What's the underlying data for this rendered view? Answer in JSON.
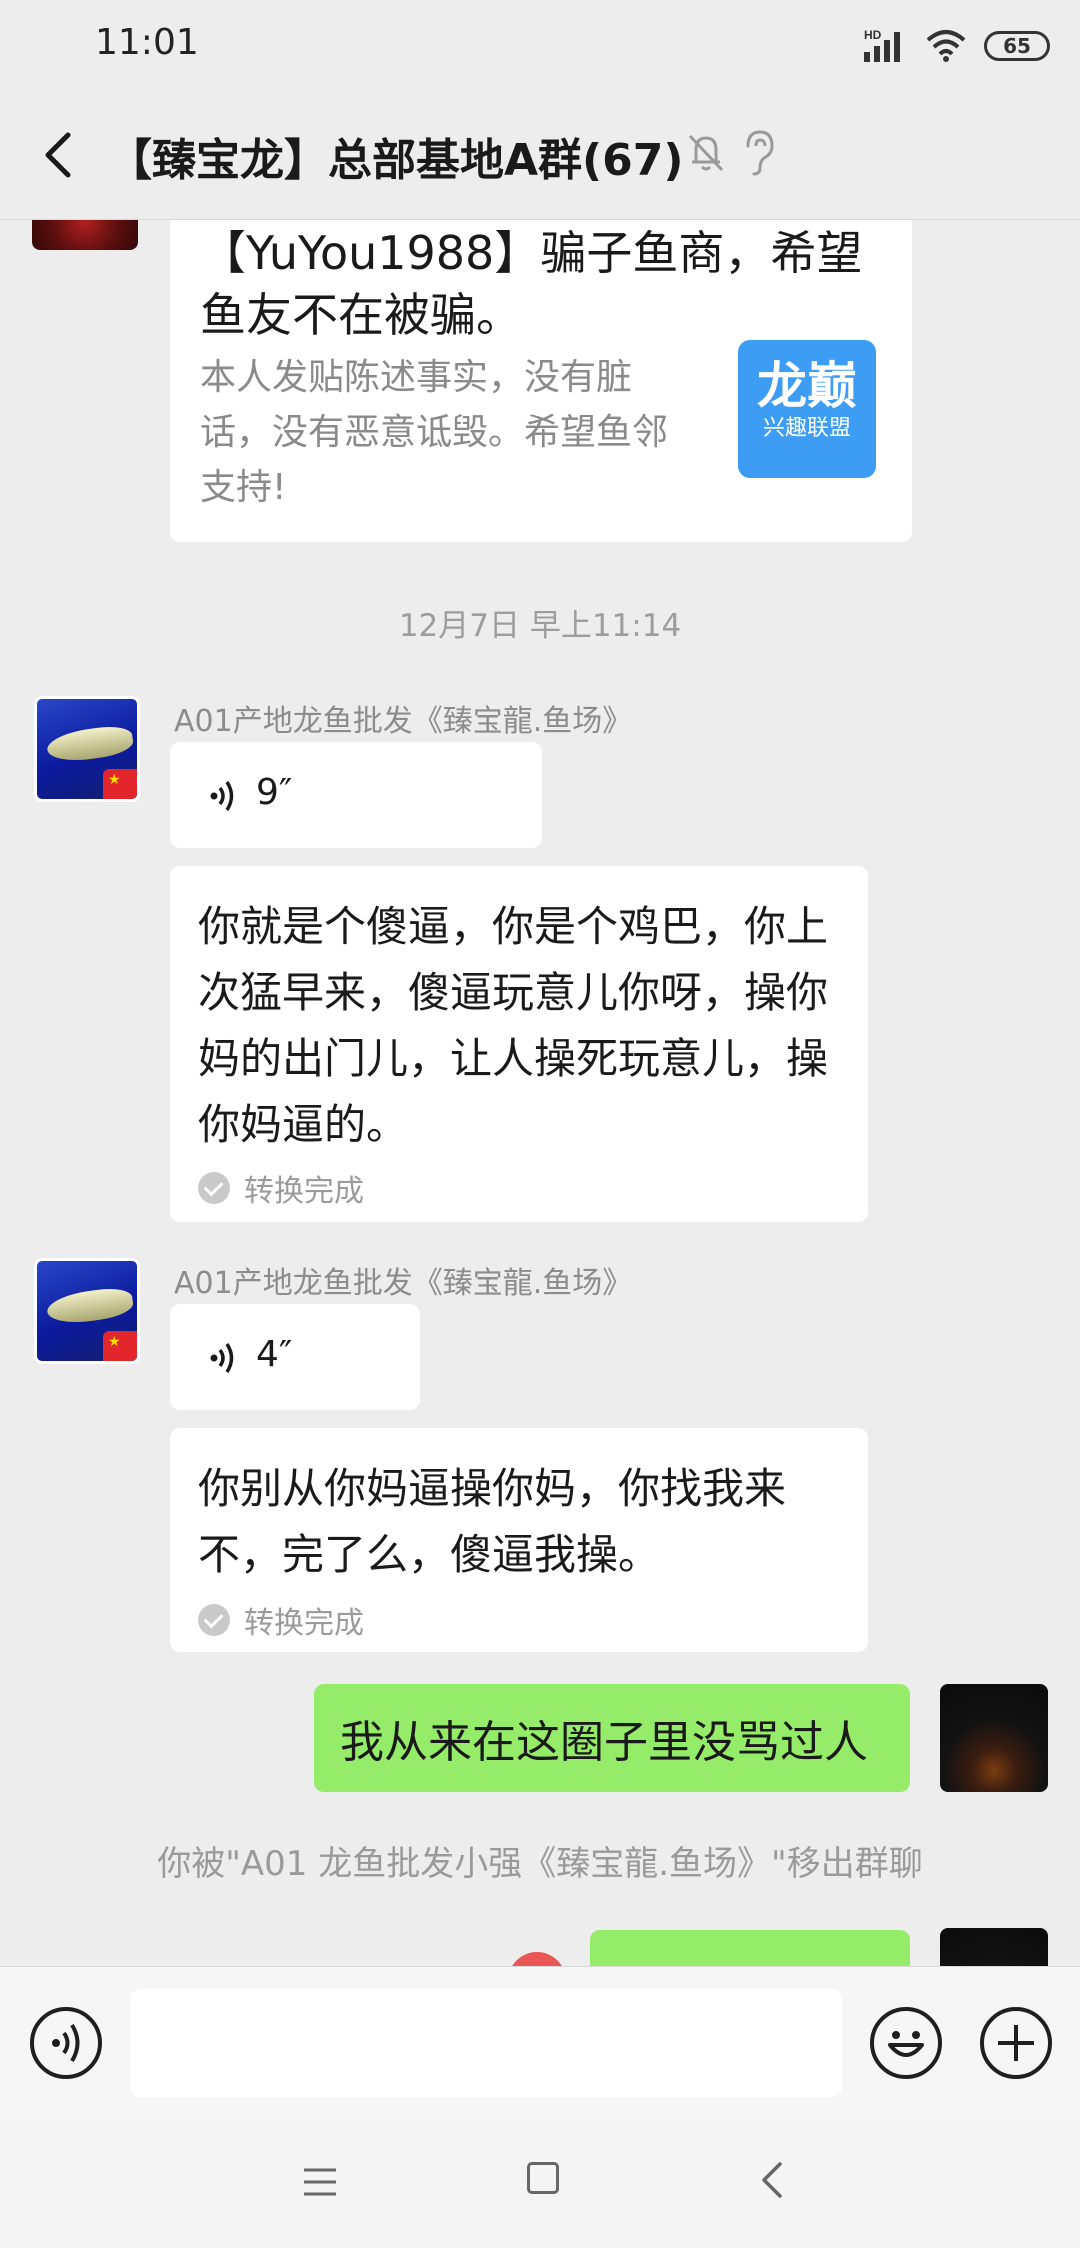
{
  "status_bar": {
    "time": "11:01",
    "battery": "65",
    "signal_label": "HD"
  },
  "header": {
    "title": "【臻宝龙】总部基地A群(67)"
  },
  "messages": {
    "link_card": {
      "title": "【YuYou1988】骗子鱼商，希望鱼友不在被骗。",
      "desc": "本人发贴陈述事实，没有脏话，没有恶意诋毁。希望鱼邻支持!",
      "logo_main": "龙巅",
      "logo_sub": "兴趣联盟"
    },
    "timestamp": "12月7日 早上11:14",
    "group1": {
      "sender": "A01产地龙鱼批发《臻宝龍.鱼场》",
      "voice_duration": "9″",
      "transcript": "你就是个傻逼，你是个鸡巴，你上次猛早来，傻逼玩意儿你呀，操你妈的出门儿，让人操死玩意儿，操你妈逼的。",
      "transcript_status": "转换完成"
    },
    "group2": {
      "sender": "A01产地龙鱼批发《臻宝龍.鱼场》",
      "voice_duration": "4″",
      "transcript": "你别从你妈逼操你妈，你找我来不，完了么，傻逼我操。",
      "transcript_status": "转换完成"
    },
    "self_msg": {
      "text": "我从来在这圈子里没骂过人"
    },
    "system": {
      "text": "你被\"A01 龙鱼批发小强《臻宝龍.鱼场》\"移出群聊"
    }
  },
  "input_bar": {
    "placeholder": ""
  },
  "icons": {
    "back": "back-arrow-icon",
    "mute": "bell-off-icon",
    "ear": "ear-icon",
    "voice": "voice-icon",
    "emoji": "emoji-icon",
    "plus": "plus-icon"
  },
  "colors": {
    "background": "#ededed",
    "self_bubble": "#95ec69",
    "other_bubble": "#ffffff",
    "link_logo": "#3d9df5"
  }
}
